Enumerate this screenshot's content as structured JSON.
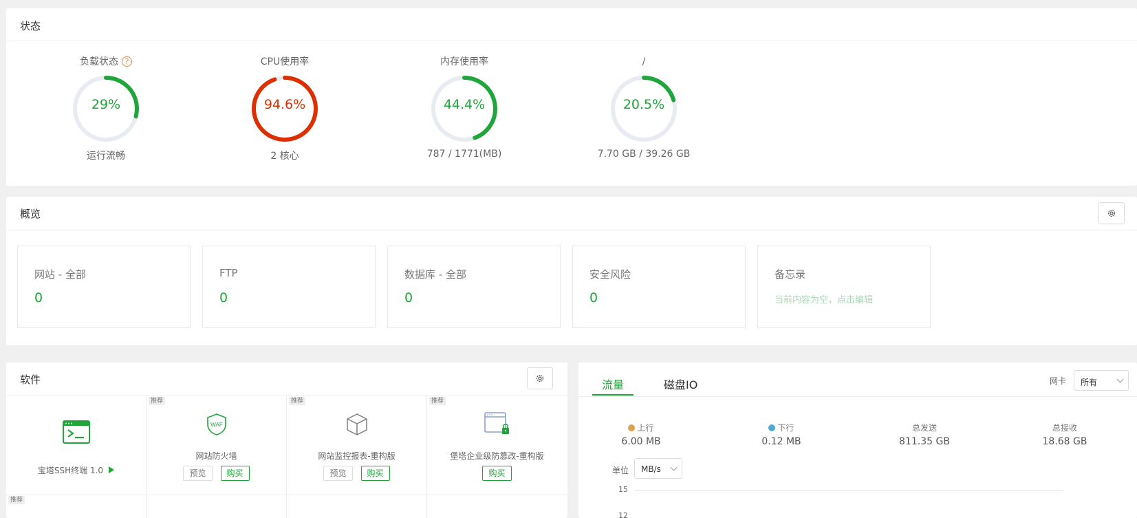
{
  "status": {
    "title": "状态",
    "gauges": [
      {
        "title": "负载状态",
        "value": "29%",
        "percent": 29,
        "sub": "运行流畅",
        "color": "#20a53a",
        "help": "?"
      },
      {
        "title": "CPU使用率",
        "value": "94.6%",
        "percent": 94.6,
        "sub": "2 核心",
        "color": "#dd2f00"
      },
      {
        "title": "内存使用率",
        "value": "44.4%",
        "percent": 44.4,
        "sub": "787 / 1771(MB)",
        "color": "#20a53a"
      },
      {
        "title": "/",
        "value": "20.5%",
        "percent": 20.5,
        "sub": "7.70 GB / 39.26 GB",
        "color": "#20a53a"
      }
    ]
  },
  "overview": {
    "title": "概览",
    "settings_icon": "gear-icon",
    "boxes": [
      {
        "label": "网站 - 全部",
        "value": "0"
      },
      {
        "label": "FTP",
        "value": "0"
      },
      {
        "label": "数据库 - 全部",
        "value": "0"
      },
      {
        "label": "安全风险",
        "value": "0"
      },
      {
        "label": "备忘录",
        "memo": "当前内容为空，点击编辑"
      }
    ]
  },
  "software": {
    "title": "软件",
    "badge": "推荐",
    "items": [
      {
        "name": "宝塔SSH终端 1.0",
        "icon": "terminal-icon"
      },
      {
        "name": "网站防火墙",
        "icon": "waf-shield-icon",
        "icon_text": "WAF",
        "preview": "预览",
        "buy": "购买"
      },
      {
        "name": "网站监控报表-重构版",
        "icon": "cube-icon",
        "preview": "预览",
        "buy": "购买"
      },
      {
        "name": "堡塔企业级防篡改-重构版",
        "icon": "locked-window-icon",
        "buy": "购买"
      }
    ]
  },
  "traffic": {
    "tabs": [
      "流量",
      "磁盘IO"
    ],
    "active_tab": "流量",
    "nic_label": "网卡",
    "nic_value": "所有",
    "stats": [
      {
        "label": "上行",
        "value": "6.00 MB",
        "dot_color": "#e0a14c"
      },
      {
        "label": "下行",
        "value": "0.12 MB",
        "dot_color": "#52a9d3"
      },
      {
        "label": "总发送",
        "value": "811.35 GB"
      },
      {
        "label": "总接收",
        "value": "18.68 GB"
      }
    ],
    "unit_label": "单位",
    "unit_value": "MB/s",
    "y_ticks": [
      "15",
      "12"
    ]
  }
}
